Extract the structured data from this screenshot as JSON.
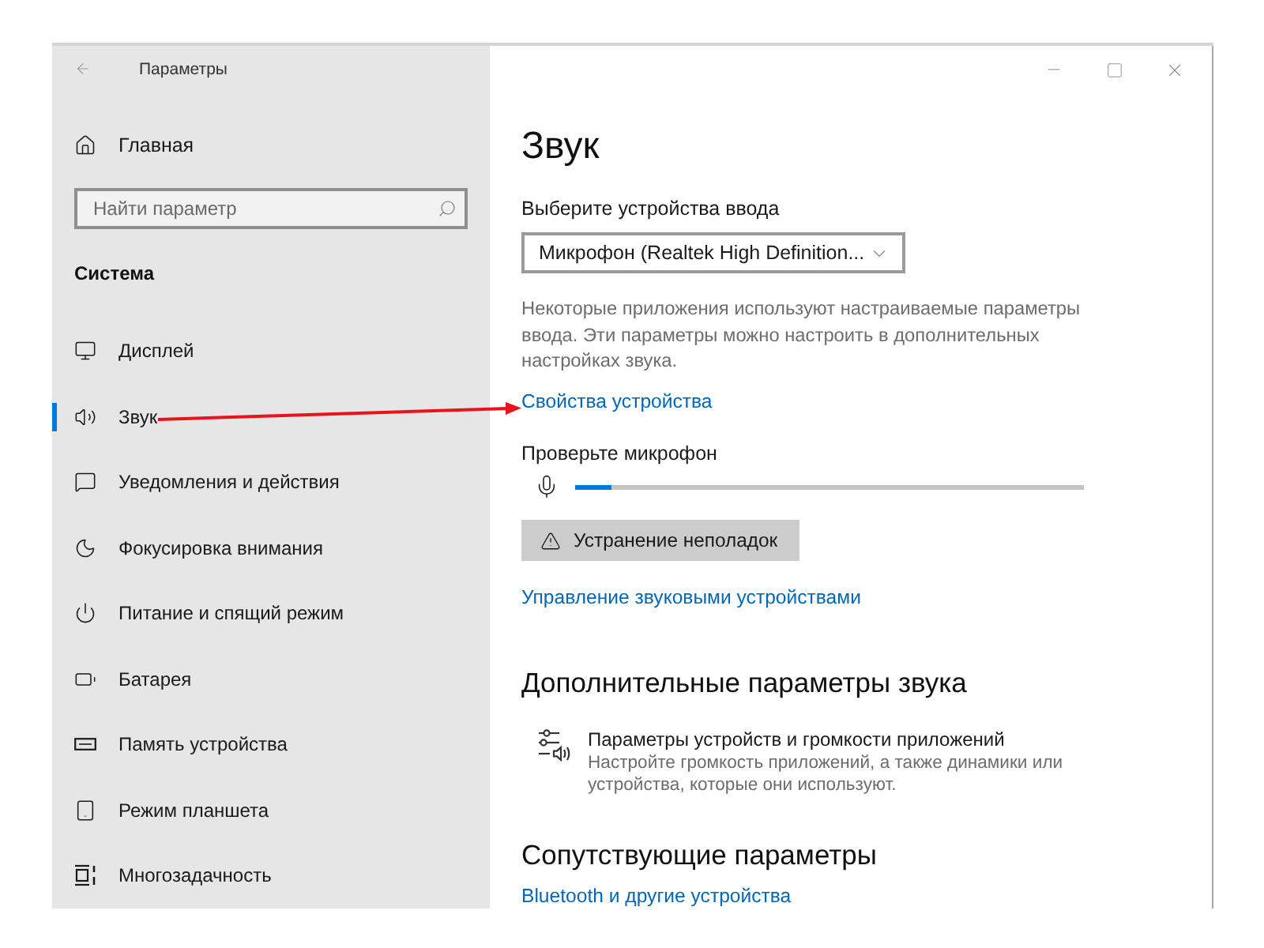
{
  "window": {
    "title": "Параметры"
  },
  "sidebar": {
    "home": "Главная",
    "search": {
      "placeholder": "Найти параметр"
    },
    "section": "Система",
    "items": [
      {
        "label": "Дисплей",
        "selected": false
      },
      {
        "label": "Звук",
        "selected": true
      },
      {
        "label": "Уведомления и действия",
        "selected": false
      },
      {
        "label": "Фокусировка внимания",
        "selected": false
      },
      {
        "label": "Питание и спящий режим",
        "selected": false
      },
      {
        "label": "Батарея",
        "selected": false
      },
      {
        "label": "Память устройства",
        "selected": false
      },
      {
        "label": "Режим планшета",
        "selected": false
      },
      {
        "label": "Многозадачность",
        "selected": false
      }
    ]
  },
  "page": {
    "title": "Звук",
    "input_device": {
      "label": "Выберите устройства ввода",
      "value": "Микрофон (Realtek High Definition..."
    },
    "note": "Некоторые приложения используют настраиваемые параметры ввода. Эти параметры можно настроить в дополнительных настройках звука.",
    "device_properties_link": "Свойства устройства",
    "mic_test": {
      "label": "Проверьте микрофон",
      "level": 0.07
    },
    "troubleshoot_button": "Устранение неполадок",
    "manage_devices_link": "Управление звуковыми устройствами"
  },
  "advanced": {
    "heading": "Дополнительные параметры звука",
    "item": {
      "title": "Параметры устройств и громкости приложений",
      "description": "Настройте громкость приложений, а также динамики или устройства, которые они используют."
    }
  },
  "related": {
    "heading": "Сопутствующие параметры",
    "links": [
      "Bluetooth и другие устройства"
    ]
  }
}
